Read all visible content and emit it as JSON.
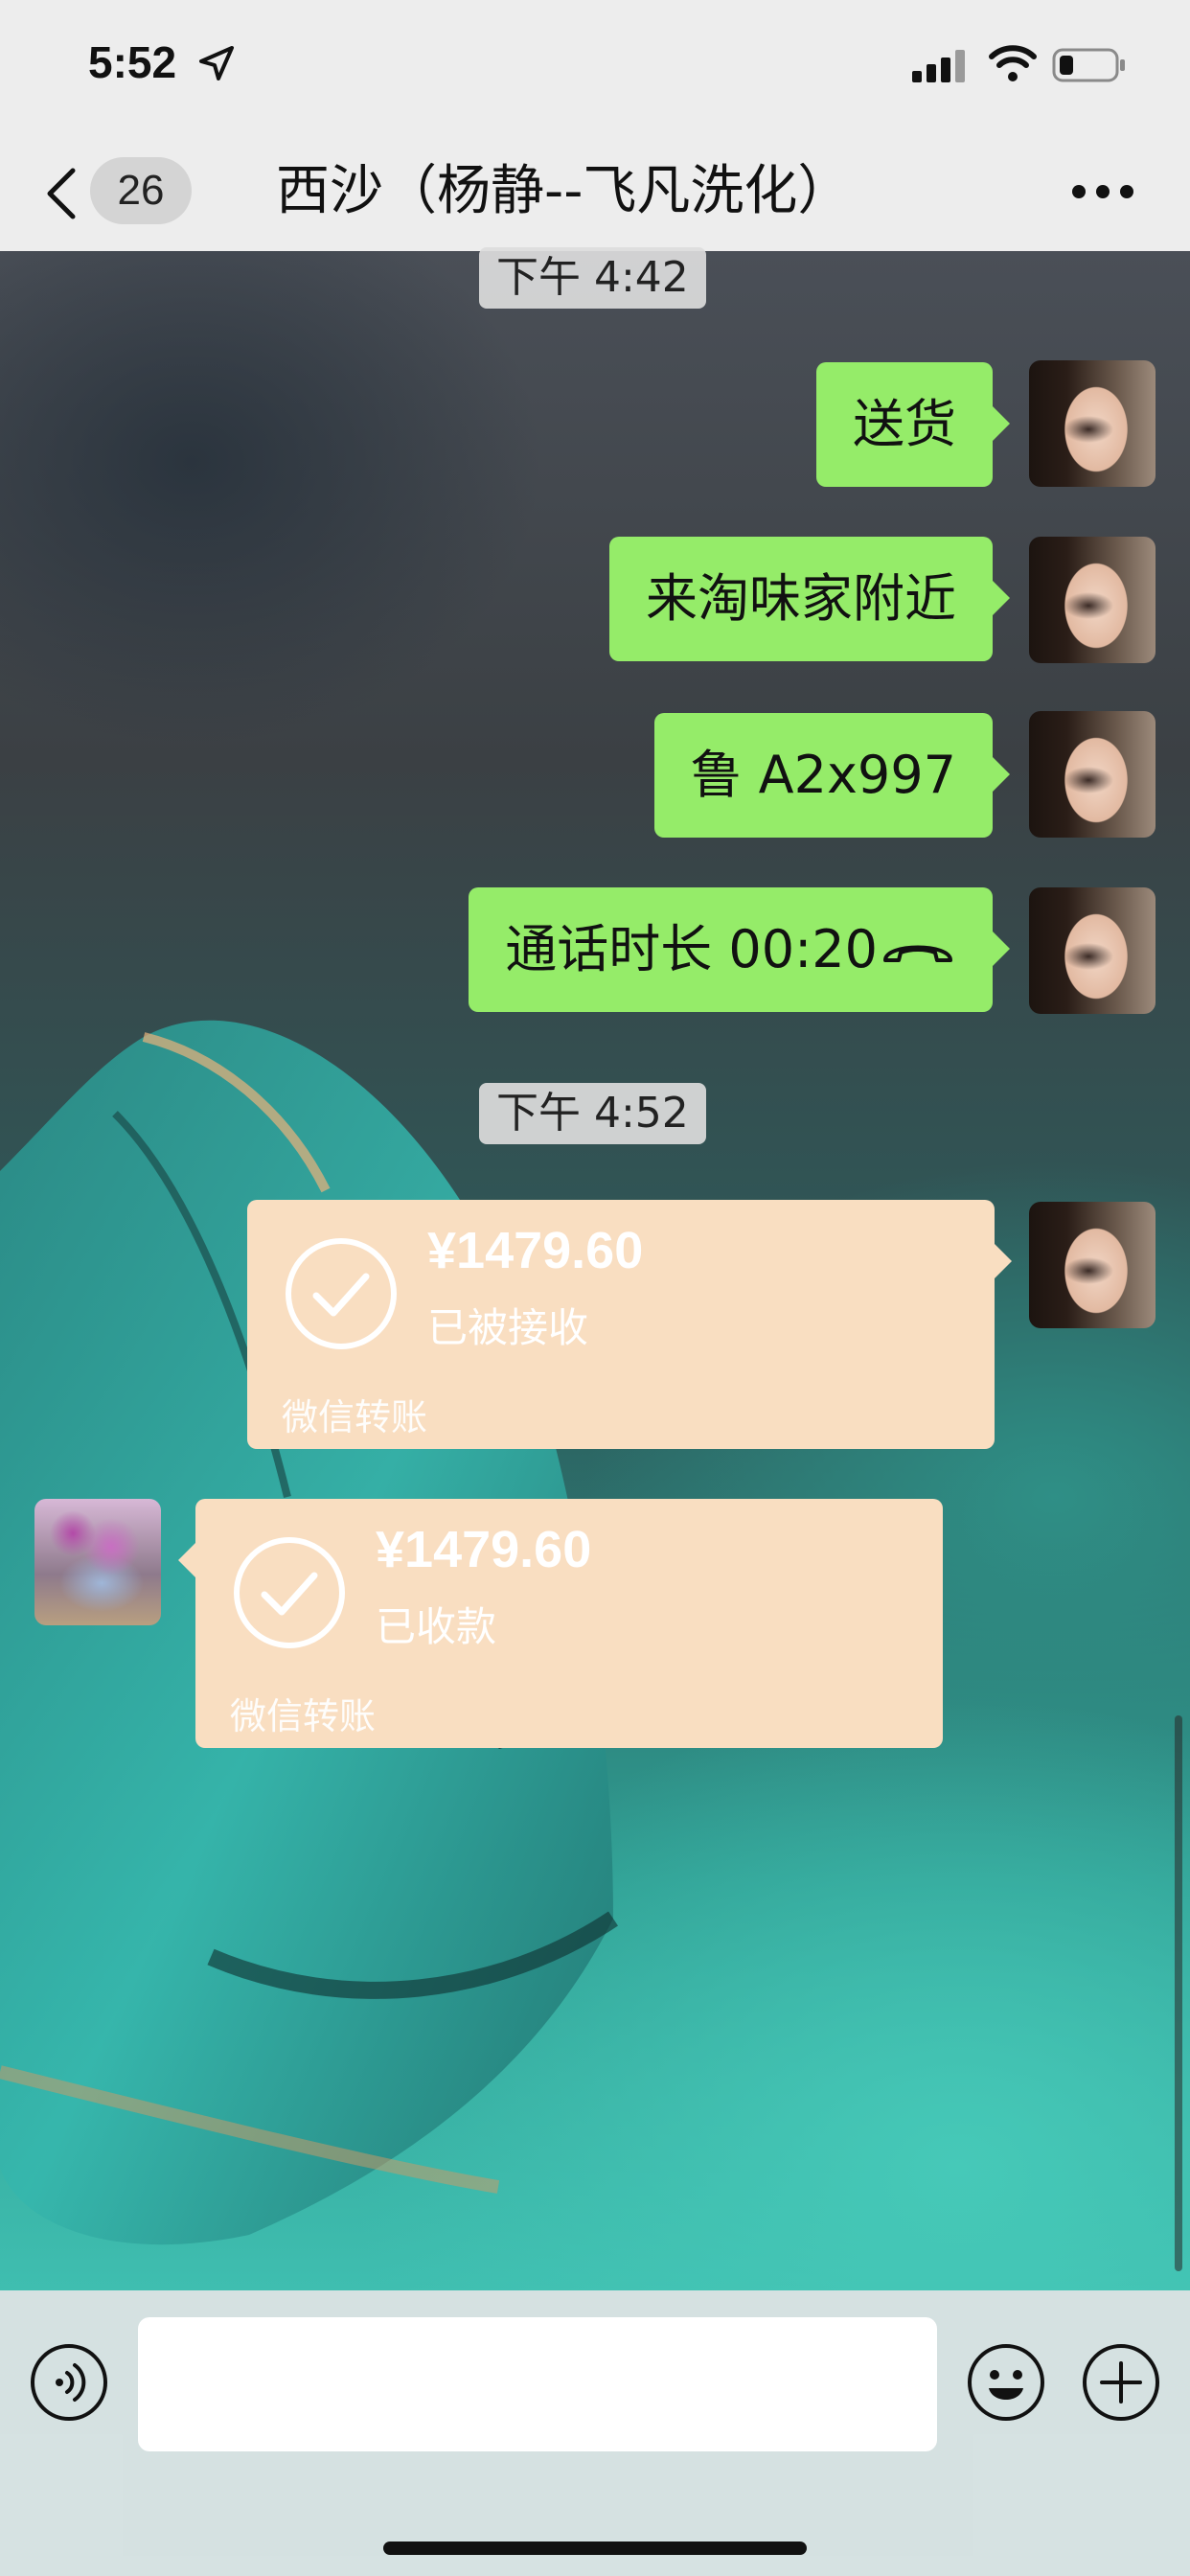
{
  "status_bar": {
    "time": "5:52",
    "icons": [
      "location-arrow-icon",
      "cellular-signal-icon",
      "wifi-icon",
      "battery-icon"
    ]
  },
  "nav": {
    "back_icon": "chevron-left-icon",
    "unread_count": "26",
    "title": "西沙（杨静--飞凡洗化）",
    "more_icon": "ellipsis-icon"
  },
  "messages": {
    "stamp1": "下午 4:42",
    "msg1": "送货",
    "msg2": "来淘味家附近",
    "msg3": "鲁 A2x997",
    "msg4": "通话时长 00:20",
    "stamp2": "下午 4:52",
    "transfer1": {
      "amount": "¥1479.60",
      "status": "已被接收",
      "brand": "微信转账"
    },
    "transfer2": {
      "amount": "¥1479.60",
      "status": "已收款",
      "brand": "微信转账"
    }
  },
  "input_bar": {
    "placeholder": "",
    "icons": [
      "voice-icon",
      "emoji-icon",
      "plus-icon"
    ]
  },
  "colors": {
    "bubble_green": "#95ec69",
    "transfer_orange": "#f9dec1",
    "bar_gray": "#ededed"
  }
}
